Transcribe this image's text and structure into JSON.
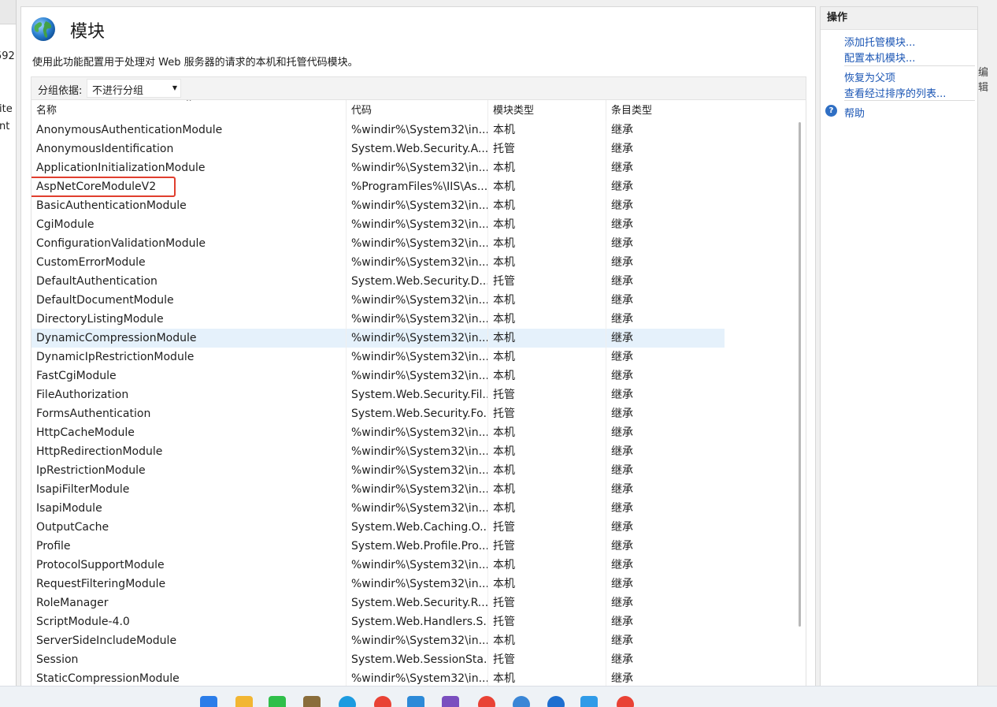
{
  "left_pane": {
    "fragments": [
      "592",
      "ite",
      "nt"
    ]
  },
  "page": {
    "title": "模块",
    "description": "使用此功能配置用于处理对 Web 服务器的请求的本机和托管代码模块。",
    "group_by_label": "分组依据:",
    "group_by_value": "不进行分组",
    "icon": "globe-icon"
  },
  "grid": {
    "columns": [
      "名称",
      "代码",
      "模块类型",
      "条目类型"
    ],
    "selected_row": "DynamicCompressionModule",
    "highlighted_row": "AspNetCoreModuleV2",
    "highlight_color": "#e03e2e",
    "rows": [
      {
        "name": "AnonymousAuthenticationModule",
        "code": "%windir%\\System32\\in...",
        "type": "本机",
        "entry": "继承"
      },
      {
        "name": "AnonymousIdentification",
        "code": "System.Web.Security.A...",
        "type": "托管",
        "entry": "继承"
      },
      {
        "name": "ApplicationInitializationModule",
        "code": "%windir%\\System32\\in...",
        "type": "本机",
        "entry": "继承"
      },
      {
        "name": "AspNetCoreModuleV2",
        "code": "%ProgramFiles%\\IIS\\As...",
        "type": "本机",
        "entry": "继承"
      },
      {
        "name": "BasicAuthenticationModule",
        "code": "%windir%\\System32\\in...",
        "type": "本机",
        "entry": "继承"
      },
      {
        "name": "CgiModule",
        "code": "%windir%\\System32\\in...",
        "type": "本机",
        "entry": "继承"
      },
      {
        "name": "ConfigurationValidationModule",
        "code": "%windir%\\System32\\in...",
        "type": "本机",
        "entry": "继承"
      },
      {
        "name": "CustomErrorModule",
        "code": "%windir%\\System32\\in...",
        "type": "本机",
        "entry": "继承"
      },
      {
        "name": "DefaultAuthentication",
        "code": "System.Web.Security.D...",
        "type": "托管",
        "entry": "继承"
      },
      {
        "name": "DefaultDocumentModule",
        "code": "%windir%\\System32\\in...",
        "type": "本机",
        "entry": "继承"
      },
      {
        "name": "DirectoryListingModule",
        "code": "%windir%\\System32\\in...",
        "type": "本机",
        "entry": "继承"
      },
      {
        "name": "DynamicCompressionModule",
        "code": "%windir%\\System32\\in...",
        "type": "本机",
        "entry": "继承"
      },
      {
        "name": "DynamicIpRestrictionModule",
        "code": "%windir%\\System32\\in...",
        "type": "本机",
        "entry": "继承"
      },
      {
        "name": "FastCgiModule",
        "code": "%windir%\\System32\\in...",
        "type": "本机",
        "entry": "继承"
      },
      {
        "name": "FileAuthorization",
        "code": "System.Web.Security.Fil...",
        "type": "托管",
        "entry": "继承"
      },
      {
        "name": "FormsAuthentication",
        "code": "System.Web.Security.Fo...",
        "type": "托管",
        "entry": "继承"
      },
      {
        "name": "HttpCacheModule",
        "code": "%windir%\\System32\\in...",
        "type": "本机",
        "entry": "继承"
      },
      {
        "name": "HttpRedirectionModule",
        "code": "%windir%\\System32\\in...",
        "type": "本机",
        "entry": "继承"
      },
      {
        "name": "IpRestrictionModule",
        "code": "%windir%\\System32\\in...",
        "type": "本机",
        "entry": "继承"
      },
      {
        "name": "IsapiFilterModule",
        "code": "%windir%\\System32\\in...",
        "type": "本机",
        "entry": "继承"
      },
      {
        "name": "IsapiModule",
        "code": "%windir%\\System32\\in...",
        "type": "本机",
        "entry": "继承"
      },
      {
        "name": "OutputCache",
        "code": "System.Web.Caching.O...",
        "type": "托管",
        "entry": "继承"
      },
      {
        "name": "Profile",
        "code": "System.Web.Profile.Pro...",
        "type": "托管",
        "entry": "继承"
      },
      {
        "name": "ProtocolSupportModule",
        "code": "%windir%\\System32\\in...",
        "type": "本机",
        "entry": "继承"
      },
      {
        "name": "RequestFilteringModule",
        "code": "%windir%\\System32\\in...",
        "type": "本机",
        "entry": "继承"
      },
      {
        "name": "RoleManager",
        "code": "System.Web.Security.R...",
        "type": "托管",
        "entry": "继承"
      },
      {
        "name": "ScriptModule-4.0",
        "code": "System.Web.Handlers.S...",
        "type": "托管",
        "entry": "继承"
      },
      {
        "name": "ServerSideIncludeModule",
        "code": "%windir%\\System32\\in...",
        "type": "本机",
        "entry": "继承"
      },
      {
        "name": "Session",
        "code": "System.Web.SessionSta...",
        "type": "托管",
        "entry": "继承"
      },
      {
        "name": "StaticCompressionModule",
        "code": "%windir%\\System32\\in...",
        "type": "本机",
        "entry": "继承"
      }
    ]
  },
  "actions": {
    "title": "操作",
    "links": [
      "添加托管模块...",
      "配置本机模块...",
      "恢复为父项",
      "查看经过排序的列表..."
    ],
    "help": "帮助",
    "link_color": "#1a55b4"
  },
  "right_edge_fragment": "编辑",
  "taskbar": {
    "icons": [
      "windows-start-icon",
      "file-explorer-icon",
      "wechat-icon",
      "iis-manager-icon",
      "edge-icon",
      "chrome-icon",
      "vscode-icon",
      "visual-studio-icon",
      "chrome-icon",
      "search-icon",
      "app-icon",
      "store-icon",
      "chrome-icon"
    ]
  }
}
